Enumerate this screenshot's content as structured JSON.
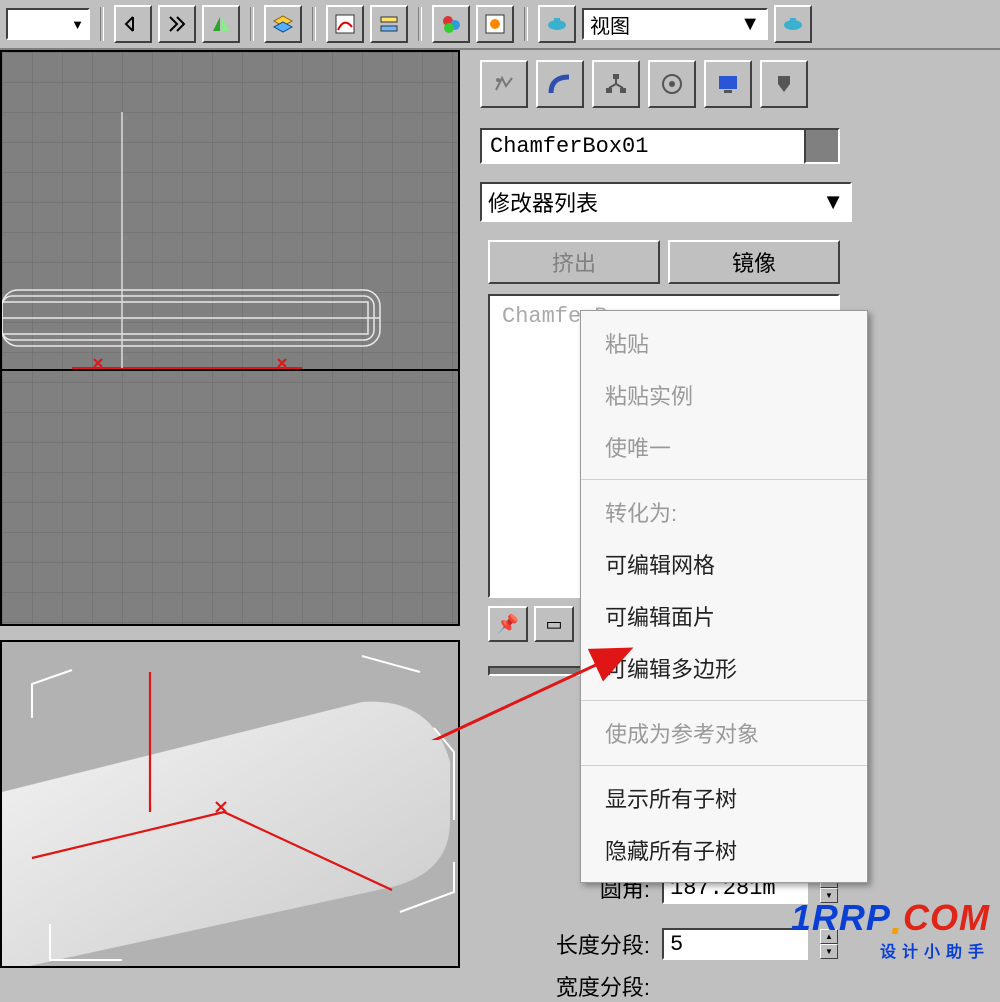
{
  "toolbar": {
    "view_combo_label": "视图"
  },
  "right_panel": {
    "object_name": "ChamferBox01",
    "modifier_list_label": "修改器列表",
    "extrude_label": "挤出",
    "mirror_label": "镜像",
    "stack_item": "ChamferBox"
  },
  "params": {
    "fillet_label": "圆角:",
    "fillet_value": "187.281m",
    "lenseg_label": "长度分段:",
    "lenseg_value": "5",
    "widseg_label": "宽度分段:"
  },
  "ctx_menu": {
    "paste": "粘贴",
    "paste_instance": "粘贴实例",
    "make_unique": "使唯一",
    "convert_header": "转化为:",
    "editable_mesh": "可编辑网格",
    "editable_patch": "可编辑面片",
    "editable_poly": "可编辑多边形",
    "make_reference": "使成为参考对象",
    "show_subtree": "显示所有子树",
    "hide_subtree": "隐藏所有子树"
  },
  "watermark": {
    "brand1": "1RRP",
    "brand2": "COM",
    "sub": "设计小助手"
  }
}
